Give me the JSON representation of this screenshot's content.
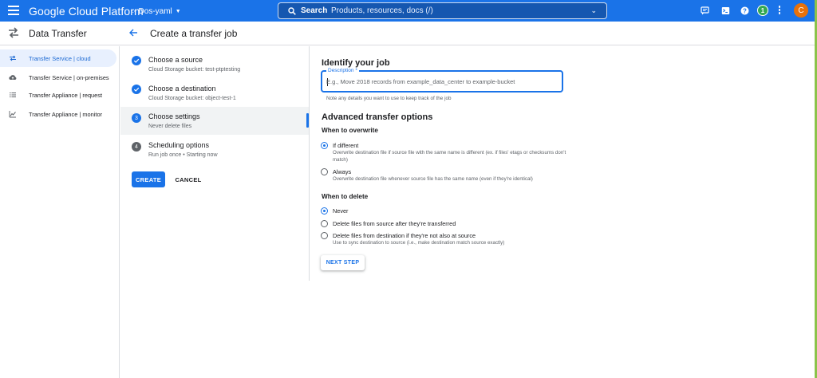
{
  "topbar": {
    "product_name": "Google Cloud Platform",
    "project": "Dos-yaml",
    "search_label": "Search",
    "search_placeholder": "Products, resources, docs (/)",
    "notification_count": "1",
    "avatar_initial": "C"
  },
  "header": {
    "service_title": "Data Transfer",
    "page_title": "Create a transfer job"
  },
  "sidebar": {
    "items": [
      {
        "label": "Transfer Service | cloud",
        "icon": "swap-icon",
        "active": true
      },
      {
        "label": "Transfer Service | on-premises",
        "icon": "cloud-upload-icon",
        "active": false
      },
      {
        "label": "Transfer Appliance | request",
        "icon": "list-icon",
        "active": false
      },
      {
        "label": "Transfer Appliance | monitor",
        "icon": "chart-icon",
        "active": false
      }
    ]
  },
  "stepper": {
    "steps": [
      {
        "title": "Choose a source",
        "subtitle": "Cloud Storage bucket: test-ptptesting",
        "state": "done"
      },
      {
        "title": "Choose a destination",
        "subtitle": "Cloud Storage bucket: object-test-1",
        "state": "done"
      },
      {
        "title": "Choose settings",
        "subtitle": "Never delete files",
        "state": "active",
        "number": "3"
      },
      {
        "title": "Scheduling options",
        "subtitle": "Run job once • Starting now",
        "state": "todo",
        "number": "4"
      }
    ],
    "create_label": "CREATE",
    "cancel_label": "CANCEL"
  },
  "form": {
    "identify_heading": "Identify your job",
    "description_label": "Description *",
    "description_placeholder": "E.g., Move 2018 records from example_data_center to example-bucket",
    "description_hint": "Note any details you want to use to keep track of the job",
    "advanced_heading": "Advanced transfer options",
    "overwrite_heading": "When to overwrite",
    "overwrite_options": [
      {
        "label": "If different",
        "description": "Overwrite destination file if source file with the same name is different (ex. if files' etags or checksums don't match)",
        "selected": true
      },
      {
        "label": "Always",
        "description": "Overwrite destination file whenever source file has the same name (even if they're identical)",
        "selected": false
      }
    ],
    "delete_heading": "When to delete",
    "delete_options": [
      {
        "label": "Never",
        "description": "",
        "selected": true
      },
      {
        "label": "Delete files from source after they're transferred",
        "description": "",
        "selected": false
      },
      {
        "label": "Delete files from destination if they're not also at source",
        "description": "Use to sync destination to source (i.e., make destination match source exactly)",
        "selected": false
      }
    ],
    "next_label": "NEXT STEP"
  },
  "colors": {
    "primary": "#1a73e8",
    "active_nav_bg": "#e8f0fe",
    "avatar": "#e8710a",
    "badge": "#34a853"
  }
}
